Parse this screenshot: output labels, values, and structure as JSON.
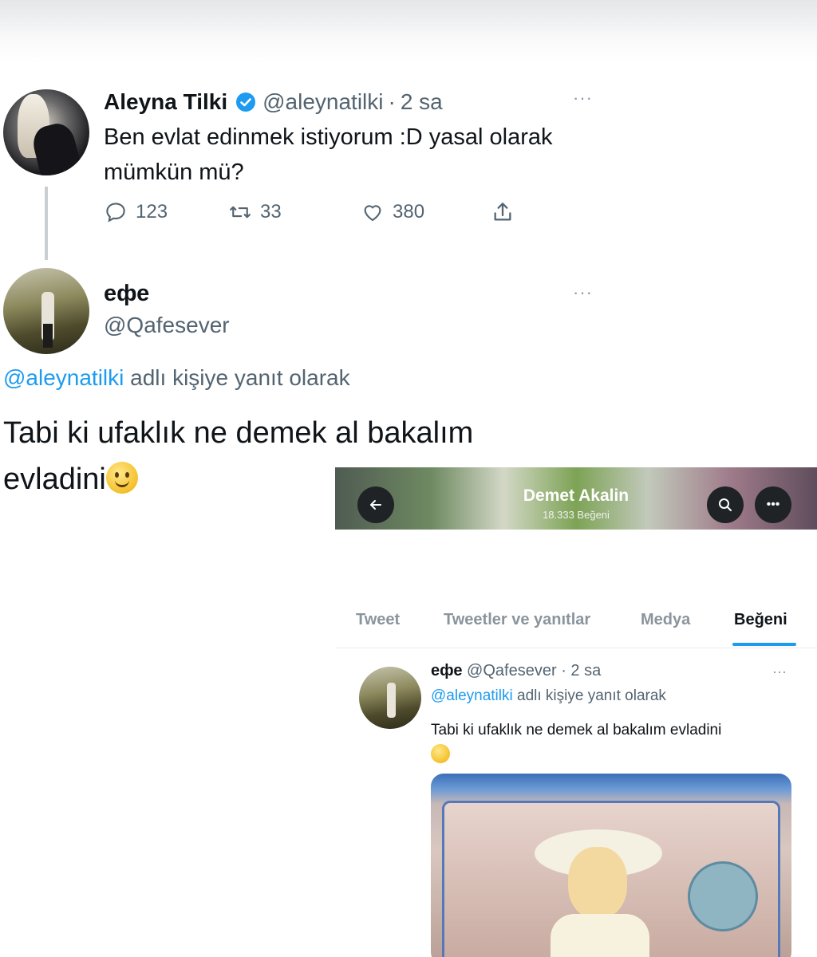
{
  "main_tweet": {
    "name": "Aleyna Tilki",
    "handle": "@aleynatilki",
    "separator": "·",
    "time": "2 sa",
    "text": "Ben evlat edinmek istiyorum :D yasal olarak mümkün mü?",
    "actions": {
      "replies": "123",
      "retweets": "33",
      "likes": "380"
    }
  },
  "reply_tweet": {
    "name": "ефе",
    "handle": "@Qafesever",
    "context_mention": "@aleynatilki",
    "context_rest": " adlı kişiye yanıt olarak",
    "text_line1": "Tabi ki ufaklık ne demek al bakalım",
    "text_line2": "evladini"
  },
  "embedded_profile": {
    "title": "Demet Akalin",
    "subtitle": "18.333 Beğeni",
    "tabs": [
      "Tweet",
      "Tweetler ve yanıtlar",
      "Medya",
      "Beğeni"
    ],
    "active_tab": "Beğeni",
    "liked_tweet": {
      "name": "ефе",
      "handle": "@Qafesever",
      "separator": "·",
      "time": "2 sa",
      "context_mention": "@aleynatilki",
      "context_rest": " adlı kişiye yanıt olarak",
      "text": "Tabi ki ufaklık ne demek al bakalım evladini"
    }
  },
  "icons": [
    "verified-icon",
    "more-icon",
    "reply-icon",
    "retweet-icon",
    "like-icon",
    "share-icon",
    "back-arrow-icon",
    "search-icon",
    "smile-emoji"
  ],
  "colors": {
    "accent": "#1d9bf0",
    "text": "#0f1419",
    "secondary": "#536471"
  }
}
